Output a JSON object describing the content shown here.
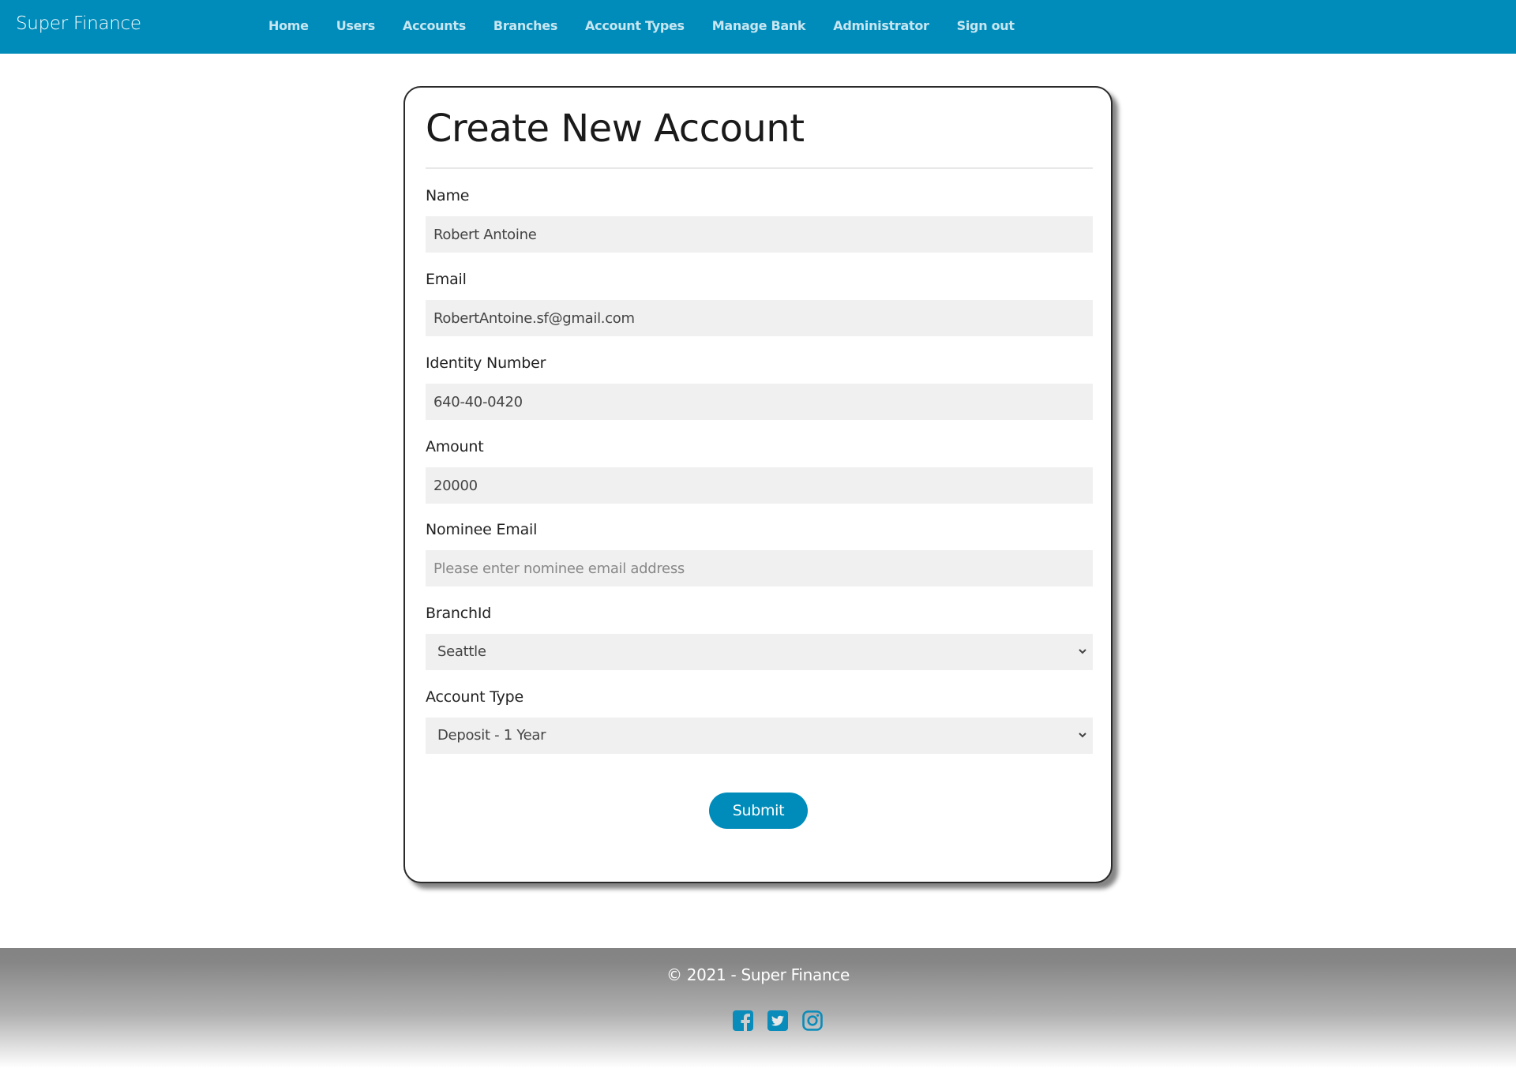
{
  "navbar": {
    "brand": "Super Finance",
    "items": [
      {
        "label": "Home"
      },
      {
        "label": "Users"
      },
      {
        "label": "Accounts"
      },
      {
        "label": "Branches"
      },
      {
        "label": "Account Types"
      },
      {
        "label": "Manage Bank"
      },
      {
        "label": "Administrator"
      },
      {
        "label": "Sign out"
      }
    ],
    "color": "#008cba"
  },
  "form": {
    "title": "Create New Account",
    "fields": {
      "name": {
        "label": "Name",
        "value": "Robert Antoine"
      },
      "email": {
        "label": "Email",
        "value": "RobertAntoine.sf@gmail.com"
      },
      "identity": {
        "label": "Identity Number",
        "value": "640-40-0420"
      },
      "amount": {
        "label": "Amount",
        "value": "20000"
      },
      "nominee": {
        "label": "Nominee Email",
        "value": "",
        "placeholder": "Please enter nominee email address"
      },
      "branch": {
        "label": "BranchId",
        "selected": "Seattle"
      },
      "account_type": {
        "label": "Account Type",
        "selected": "Deposit - 1 Year"
      }
    },
    "submit_label": "Submit"
  },
  "footer": {
    "copyright": "© 2021 - Super Finance",
    "socials": [
      "facebook-icon",
      "twitter-icon",
      "instagram-icon"
    ]
  }
}
